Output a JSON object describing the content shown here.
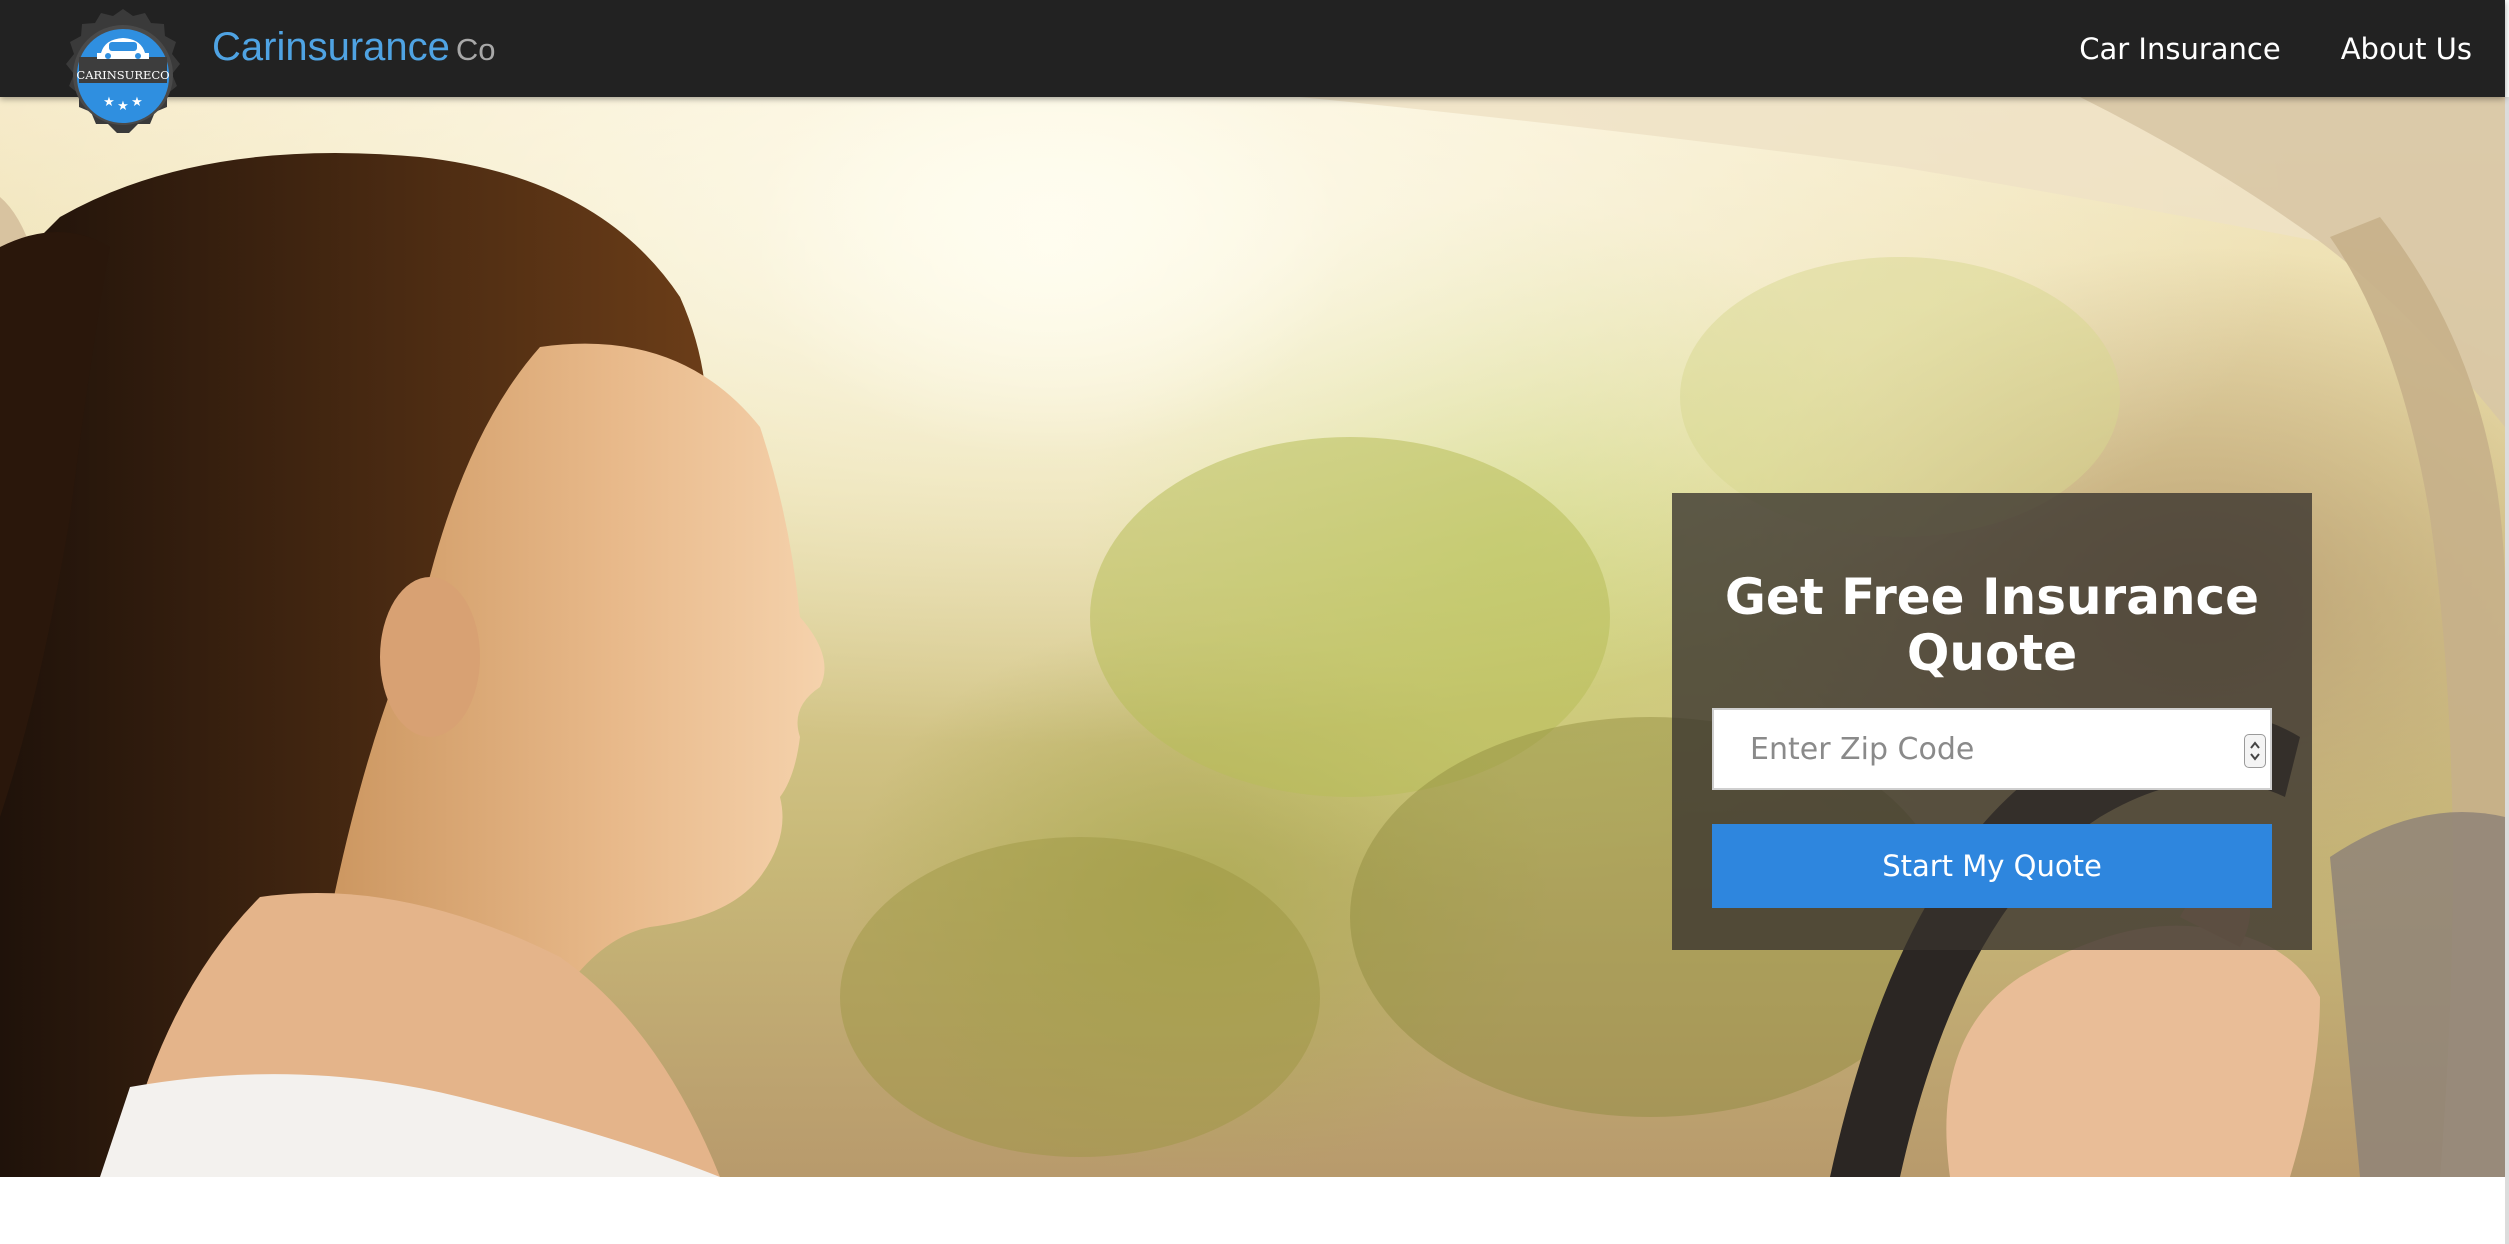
{
  "brand": {
    "logo_text": "CARINSURECO",
    "name": "Carinsurance",
    "suffix": "Co"
  },
  "nav": {
    "items": [
      {
        "label": "Car Insurance"
      },
      {
        "label": "About Us"
      }
    ]
  },
  "quote": {
    "title": "Get Free Insurance Quote",
    "zip_placeholder": "Enter Zip Code",
    "zip_value": "",
    "button_label": "Start My Quote"
  },
  "colors": {
    "navbar": "#222222",
    "brand_blue": "#4fa3e3",
    "button_blue": "#2e86de",
    "panel_overlay": "rgba(55,50,45,0.78)"
  },
  "icons": {
    "logo": "car-badge-icon",
    "spinner": "number-spinner-icon"
  }
}
